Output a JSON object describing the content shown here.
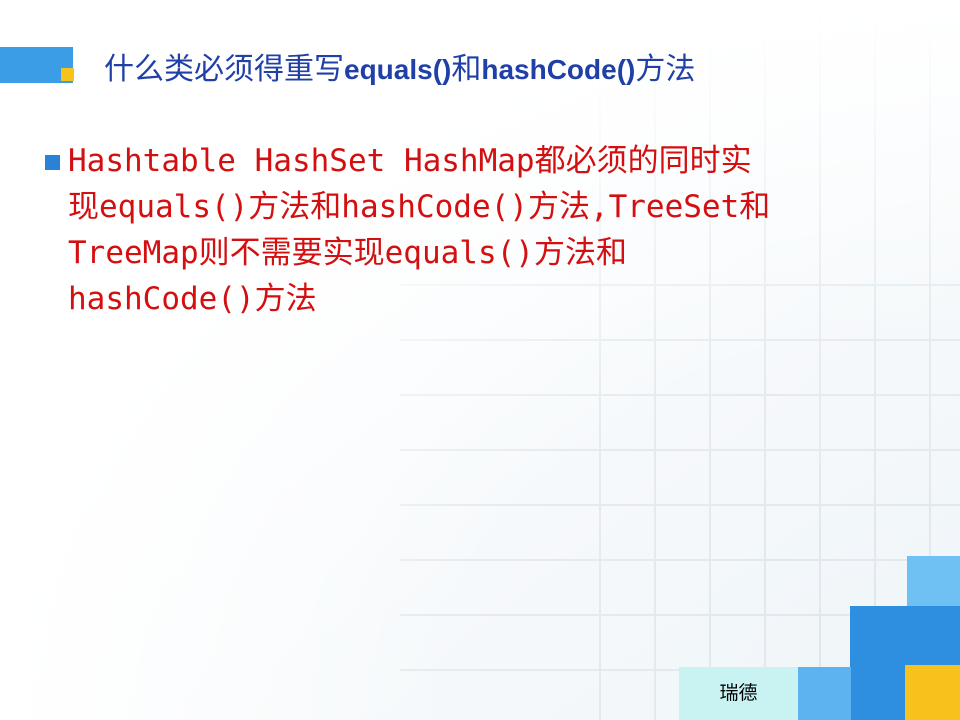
{
  "slide": {
    "title_part1": "什么类必须得重写",
    "title_part2": "equals()",
    "title_part3": "和",
    "title_part4": "hashCode()",
    "title_part5": "方法",
    "bullet_lines": [
      "Hashtable HashSet HashMap都必须的同时实",
      "现equals()方法和hashCode()方法,TreeSet和",
      "TreeMap则不需要实现equals()方法和",
      "hashCode()方法"
    ],
    "footer_label": "瑞德"
  },
  "colors": {
    "title_text": "#2040a8",
    "bullet_text": "#d30f10",
    "accent_blue": "#3a9de6",
    "accent_yellow": "#f7c21c",
    "footer_bg": "#c9f2f2"
  }
}
